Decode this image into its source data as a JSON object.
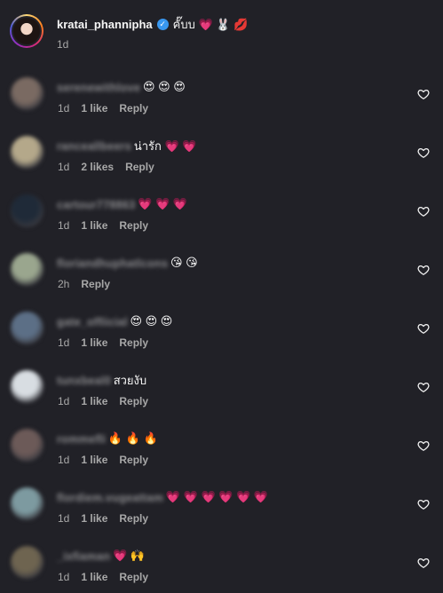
{
  "post": {
    "username": "kratai_phannipha",
    "caption": "คั๊บบ 💗 🐰 💋",
    "time": "1d",
    "verified_icon": "verified-badge-icon"
  },
  "comments": [
    {
      "username": "serenewithlove",
      "text": "😍 😍 😍",
      "time": "1d",
      "likes": "1 like",
      "reply": "Reply",
      "avatar_color": "#7a6a62"
    },
    {
      "username": "ranceallbeers",
      "text": "น่ารัก 💗 💗",
      "time": "1d",
      "likes": "2 likes",
      "reply": "Reply",
      "avatar_color": "#b4a88a"
    },
    {
      "username": "cartour778863",
      "text": "💗 💗 💗",
      "time": "1d",
      "likes": "1 like",
      "reply": "Reply",
      "avatar_color": "#1f2a38"
    },
    {
      "username": "floriandhuphatlcons",
      "text": "😘 😘",
      "time": "2h",
      "likes": "",
      "reply": "Reply",
      "avatar_color": "#9aa68e"
    },
    {
      "username": "gate_offiicial",
      "text": "😍 😍 😍",
      "time": "1d",
      "likes": "1 like",
      "reply": "Reply",
      "avatar_color": "#5c6f86"
    },
    {
      "username": "tunxbeal0",
      "text": "สวยงับ",
      "time": "1d",
      "likes": "1 like",
      "reply": "Reply",
      "avatar_color": "#d8dde2"
    },
    {
      "username": "rommefli",
      "text": "🔥 🔥 🔥",
      "time": "1d",
      "likes": "1 like",
      "reply": "Reply",
      "avatar_color": "#6c5a58"
    },
    {
      "username": "flordiem.vugeattam",
      "text": "💗 💗 💗 💗 💗 💗",
      "time": "1d",
      "likes": "1 like",
      "reply": "Reply",
      "avatar_color": "#7d9aa0"
    },
    {
      "username": "_ixfiaman",
      "text": "💗 🙌",
      "time": "1d",
      "likes": "1 like",
      "reply": "Reply",
      "avatar_color": "#6e6450"
    }
  ]
}
